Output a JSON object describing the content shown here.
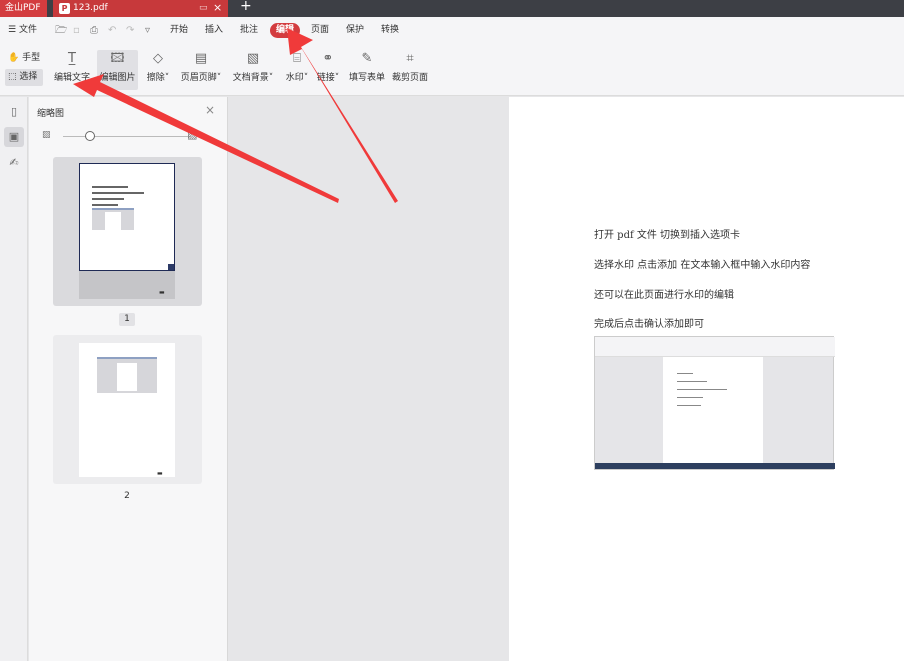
{
  "titlebar": {
    "app_name": "金山PDF",
    "doc_tab": "123.pdf",
    "new_tab": "+"
  },
  "menubar": {
    "file": "文件",
    "tabs": [
      "开始",
      "插入",
      "批注",
      "编辑",
      "页面",
      "保护",
      "转换"
    ],
    "active_tab": "编辑"
  },
  "toolbar": {
    "hand_mode": "手型",
    "select_mode": "选择",
    "tools": [
      "编辑文字",
      "编辑图片",
      "擦除",
      "页眉页脚",
      "文档背景",
      "水印",
      "链接",
      "填写表单",
      "裁剪页面"
    ],
    "selected_tool": "编辑图片"
  },
  "thumbnail_panel": {
    "title": "缩略图",
    "pages": [
      "1",
      "2"
    ],
    "current_page": "1"
  },
  "page_content": {
    "lines": [
      "打开 pdf 文件   切换到插入选项卡",
      "选择水印      点击添加   在文本输入框中输入水印内容",
      "还可以在此页面进行水印的编辑",
      "完成后点击确认添加即可"
    ]
  },
  "annotation": {
    "arrow_color": "#f03a3a",
    "targets": [
      "编辑",
      "编辑文字"
    ]
  }
}
